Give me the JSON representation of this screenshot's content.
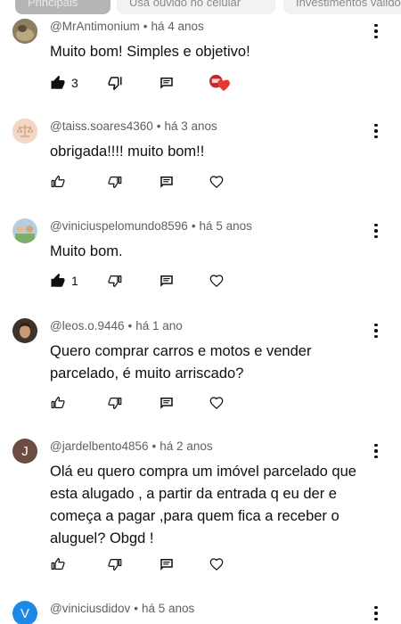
{
  "filter_chips": [
    {
      "label": "Principais"
    },
    {
      "label": "Usa ouvido no celular"
    },
    {
      "label": "Investimentos válidos"
    }
  ],
  "comments": [
    {
      "author": "@MrAntimonium",
      "time": "há 4 anos",
      "text": "Muito bom! Simples e objetivo!",
      "likes": "3",
      "creator_heart": true,
      "avatar_letter": "",
      "avatar_color": "#7a6b52"
    },
    {
      "author": "@taiss.soares4360",
      "time": "há 3 anos",
      "text": "obrigada!!!! muito bom!!",
      "likes": "",
      "creator_heart": false,
      "avatar_letter": "",
      "avatar_color": "#f3d2c1"
    },
    {
      "author": "@viniciuspelomundo8596",
      "time": "há 5 anos",
      "text": "Muito bom.",
      "likes": "1",
      "creator_heart": false,
      "avatar_letter": "",
      "avatar_color": "#9bb7d4"
    },
    {
      "author": "@leos.o.9446",
      "time": "há 1 ano",
      "text": "Quero comprar carros e motos e vender parcelado, é muito arriscado?",
      "likes": "",
      "creator_heart": false,
      "avatar_letter": "",
      "avatar_color": "#5a4a3c"
    },
    {
      "author": "@jardelbento4856",
      "time": "há 2 anos",
      "text": "Olá eu quero compra um imóvel parcelado que esta alugado , a partir da entrada q eu der e começa a pagar ,para quem fica a receber o aluguel? Obgd !",
      "likes": "",
      "creator_heart": false,
      "avatar_letter": "J",
      "avatar_color": "#6d4c41"
    },
    {
      "author": "@viniciusdidov",
      "time": "há 5 anos",
      "text": "",
      "likes": "",
      "creator_heart": false,
      "avatar_letter": "V",
      "avatar_color": "#1e88e5"
    }
  ],
  "icons": {
    "like": "thumb-up-icon",
    "dislike": "thumb-down-icon",
    "reply": "reply-icon",
    "heart": "heart-icon",
    "more": "more-vert-icon"
  },
  "colors": {
    "meta_text": "#606060",
    "heart_red": "#e53935"
  }
}
